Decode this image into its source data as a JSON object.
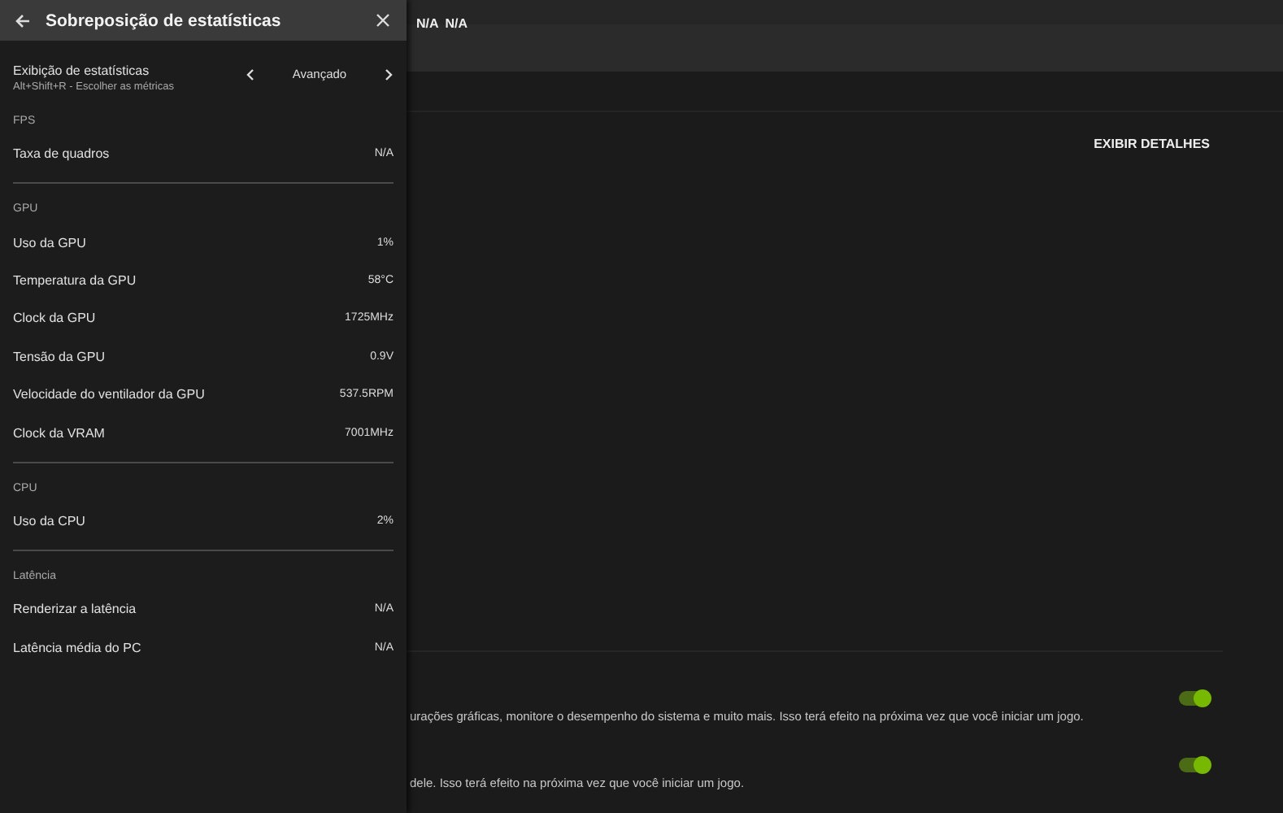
{
  "background": {
    "top_bar_values": [
      "N/A",
      "N/A"
    ],
    "details_button": "EXIBIR DETALHES",
    "settings": [
      {
        "description": "urações gráficas, monitore o desempenho do sistema e muito mais. Isso terá efeito na próxima vez que você iniciar um jogo.",
        "on": true
      },
      {
        "description": "dele. Isso terá efeito na próxima vez que você iniciar um jogo.",
        "on": true
      }
    ]
  },
  "panel": {
    "title": "Sobreposição de estatísticas",
    "display": {
      "label": "Exibição de estatísticas",
      "hint": "Alt+Shift+R - Escolher as métricas",
      "value": "Avançado"
    },
    "sections": [
      {
        "heading": "FPS",
        "rows": [
          {
            "label": "Taxa de quadros",
            "value": "N/A"
          }
        ]
      },
      {
        "heading": "GPU",
        "rows": [
          {
            "label": "Uso da GPU",
            "value": "1%"
          },
          {
            "label": "Temperatura da GPU",
            "value": "58°C"
          },
          {
            "label": "Clock da GPU",
            "value": "1725MHz"
          },
          {
            "label": "Tensão da GPU",
            "value": "0.9V"
          },
          {
            "label": "Velocidade do ventilador da GPU",
            "value": "537.5RPM"
          },
          {
            "label": "Clock da VRAM",
            "value": "7001MHz"
          }
        ]
      },
      {
        "heading": "CPU",
        "rows": [
          {
            "label": "Uso da CPU",
            "value": "2%"
          }
        ]
      },
      {
        "heading": "Latência",
        "rows": [
          {
            "label": "Renderizar a latência",
            "value": "N/A"
          },
          {
            "label": "Latência média do PC",
            "value": "N/A"
          }
        ]
      }
    ]
  }
}
